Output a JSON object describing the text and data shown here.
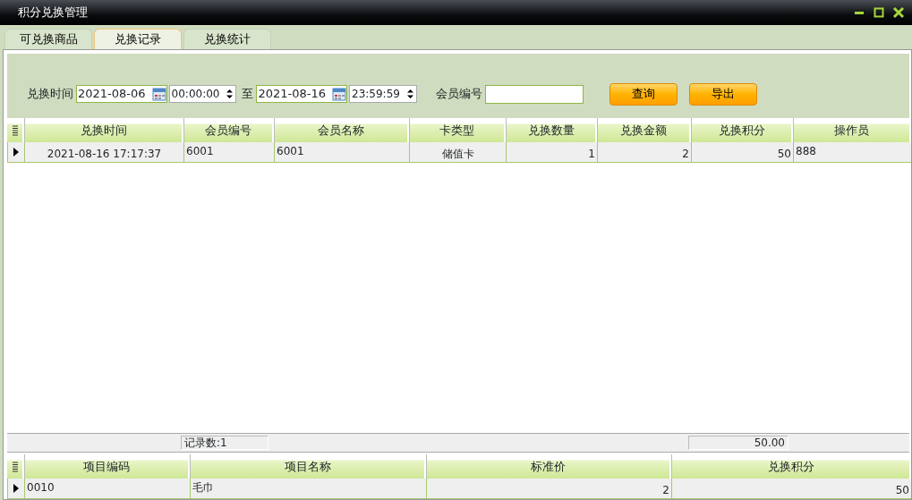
{
  "window": {
    "title": "积分兑换管理"
  },
  "tabs": [
    {
      "label": "可兑换商品",
      "selected": false
    },
    {
      "label": "兑换记录",
      "selected": true
    },
    {
      "label": "兑换统计",
      "selected": false
    }
  ],
  "filter": {
    "time_label": "兑换时间",
    "start_date": "2021-08-06",
    "start_time": "00:00:00",
    "to_label": "至",
    "end_date": "2021-08-16",
    "end_time": "23:59:59",
    "member_label": "会员编号",
    "buttons": [
      "查询",
      "导出"
    ]
  },
  "records": {
    "columns": [
      "兑换时间",
      "会员编号",
      "会员名称",
      "卡类型",
      "兑换数量",
      "兑换金额",
      "兑换积分",
      "操作员"
    ],
    "rows": [
      {
        "selected": true,
        "cells": [
          "2021-08-16 17:17:37",
          "6001",
          "6001",
          "储值卡",
          "1",
          "2",
          "50",
          "888"
        ]
      }
    ],
    "footer": {
      "count": "记录数:1",
      "points_total": "50.00"
    }
  },
  "details": {
    "columns": [
      "项目编码",
      "项目名称",
      "标准价",
      "兑换积分"
    ],
    "rows": [
      {
        "selected": true,
        "cells": [
          "0010",
          "毛巾",
          "2",
          "50"
        ]
      }
    ]
  }
}
